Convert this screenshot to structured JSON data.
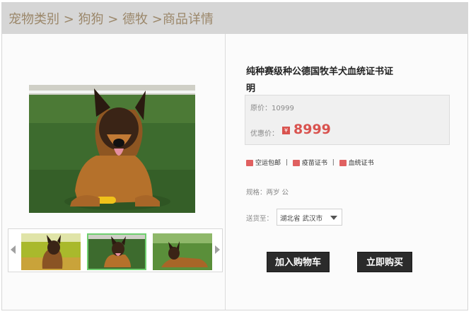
{
  "breadcrumb": {
    "text": "宠物类别 > 狗狗 > 德牧 >商品详情"
  },
  "gallery": {
    "thumbnails": [
      "thumb-1",
      "thumb-2",
      "thumb-3"
    ],
    "selected_index": 1
  },
  "product": {
    "title": "纯种赛级种公德国牧羊犬血统证书证明",
    "original_price_text": "原价：10999",
    "sale_label": "优惠价：",
    "currency_symbol": "¥",
    "sale_price": "8999",
    "features": [
      {
        "icon": "truck-icon",
        "label": "空运包邮"
      },
      {
        "icon": "vaccine-card-icon",
        "label": "疫苗证书"
      },
      {
        "icon": "pedigree-certificate-icon",
        "label": "血统证书"
      }
    ],
    "feature_separator": "|",
    "spec_text": "规格：两岁  公",
    "ship_to_label": "送货至：",
    "ship_to_value": "湖北省  武汉市"
  },
  "actions": {
    "add_to_cart": "加入购物车",
    "buy_now": "立即购买"
  },
  "colors": {
    "breadcrumb_bg": "#d6d6d6",
    "breadcrumb_text": "#9b876a",
    "price_red": "#d9534f",
    "button_dark": "#2b2b2b",
    "thumb_selected_border": "#6fcf6f"
  }
}
